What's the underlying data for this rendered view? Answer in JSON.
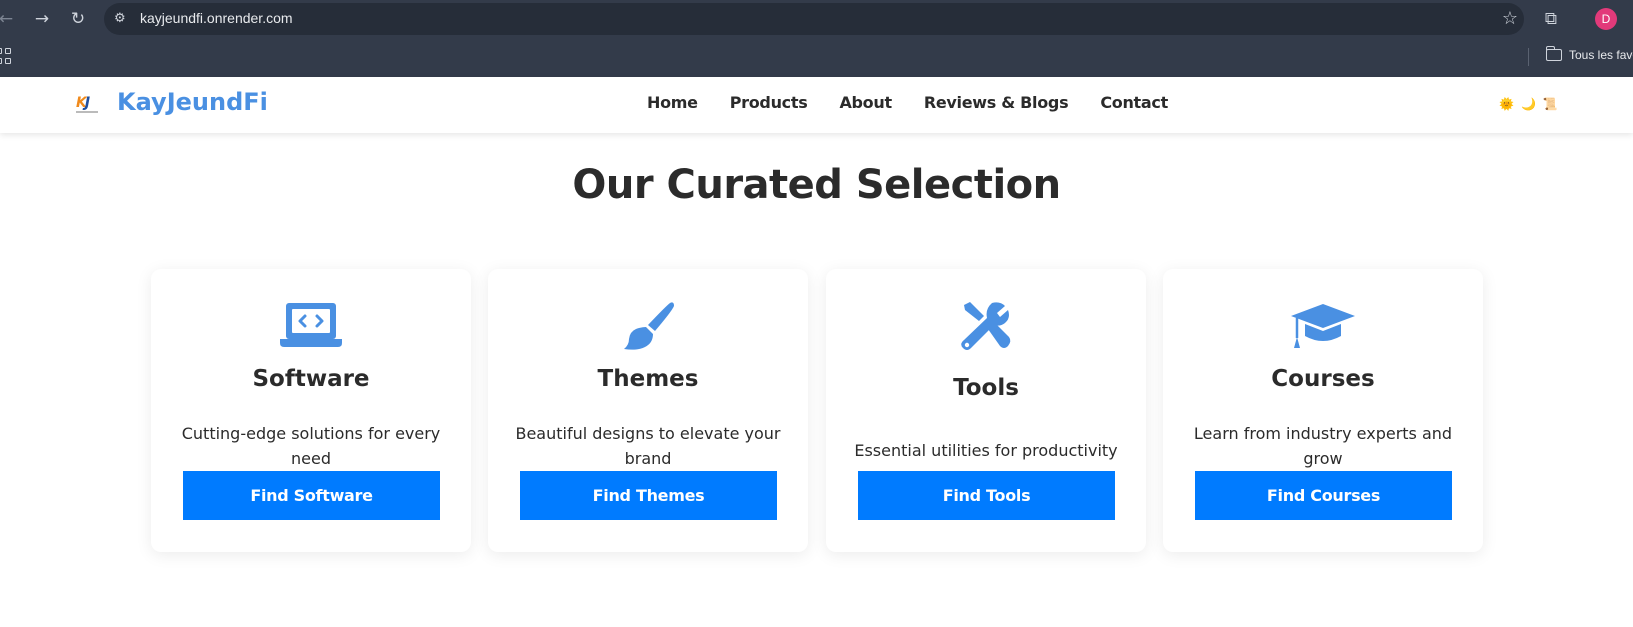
{
  "browser": {
    "url": "kayjeundfi.onrender.com",
    "profile_initial": "D",
    "bookmark_folder": "Tous les favoris"
  },
  "site": {
    "brand": "KayJeundFi",
    "logo_text": "KJ",
    "nav": [
      "Home",
      "Products",
      "About",
      "Reviews & Blogs",
      "Contact"
    ],
    "toggles": {
      "sun": "🌞",
      "moon": "🌙",
      "scroll": "📜"
    }
  },
  "main": {
    "title": "Our Curated Selection",
    "cards": [
      {
        "icon": "laptop-code-icon",
        "title": "Software",
        "desc": "Cutting-edge solutions for every need",
        "button": "Find Software"
      },
      {
        "icon": "paintbrush-icon",
        "title": "Themes",
        "desc": "Beautiful designs to elevate your brand",
        "button": "Find Themes"
      },
      {
        "icon": "tools-icon",
        "title": "Tools",
        "desc": "Essential utilities for productivity",
        "button": "Find Tools"
      },
      {
        "icon": "graduation-cap-icon",
        "title": "Courses",
        "desc": "Learn from industry experts and grow",
        "button": "Find Courses"
      }
    ]
  },
  "colors": {
    "chrome_bg": "#333b4a",
    "brand_blue": "#4a90e2",
    "button_blue": "#007bff",
    "icon_blue": "#4a90e2",
    "text_dark": "#2b2b2b"
  }
}
